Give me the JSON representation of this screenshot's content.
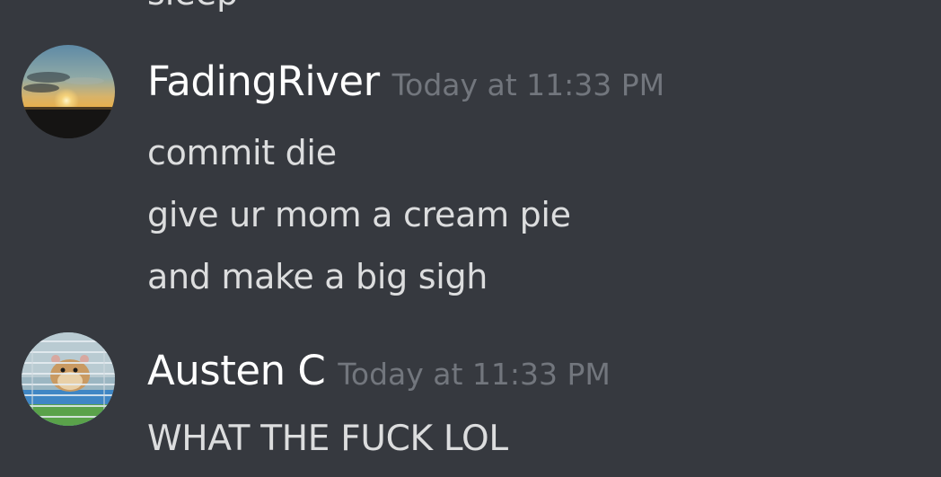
{
  "previous_message": {
    "text": "sleep"
  },
  "messages": [
    {
      "avatar_icon": "sunset-avatar-icon",
      "username": "FadingRiver",
      "timestamp": "Today at 11:33 PM",
      "lines": [
        "commit die",
        "give ur mom a cream pie",
        "and make a big sigh"
      ]
    },
    {
      "avatar_icon": "hamster-avatar-icon",
      "username": "Austen C",
      "timestamp": "Today at 11:33 PM",
      "lines": [
        "WHAT THE FUCK LOL"
      ]
    }
  ],
  "colors": {
    "background": "#36393f",
    "username": "#ffffff",
    "timestamp": "#72767d",
    "message_text": "#dcddde"
  }
}
